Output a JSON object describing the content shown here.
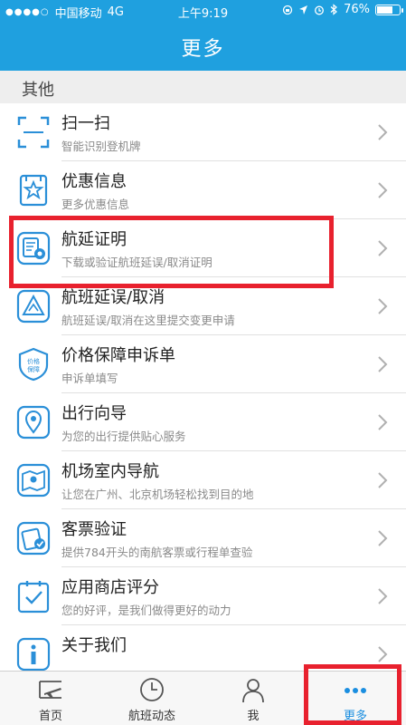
{
  "status_bar": {
    "carrier": "中国移动",
    "network": "4G",
    "time": "上午9:19",
    "battery_text": "76%",
    "battery_level": 0.76
  },
  "header": {
    "title": "更多"
  },
  "section": {
    "label": "其他"
  },
  "items": [
    {
      "title": "扫一扫",
      "subtitle": "智能识别登机牌",
      "icon": "scan-icon"
    },
    {
      "title": "优惠信息",
      "subtitle": "更多优惠信息",
      "icon": "promo-icon"
    },
    {
      "title": "航延证明",
      "subtitle": "下载或验证航班延误/取消证明",
      "icon": "certificate-icon"
    },
    {
      "title": "航班延误/取消",
      "subtitle": "航班延误/取消在这里提交变更申请",
      "icon": "delay-icon"
    },
    {
      "title": "价格保障申诉单",
      "subtitle": "申诉单填写",
      "icon": "price-guarantee-icon",
      "icon_text": "价格保障"
    },
    {
      "title": "出行向导",
      "subtitle": "为您的出行提供贴心服务",
      "icon": "location-pin-icon"
    },
    {
      "title": "机场室内导航",
      "subtitle": "让您在广州、北京机场轻松找到目的地",
      "icon": "map-icon"
    },
    {
      "title": "客票验证",
      "subtitle": "提供784开头的南航客票或行程单查验",
      "icon": "ticket-verify-icon"
    },
    {
      "title": "应用商店评分",
      "subtitle": "您的好评，是我们做得更好的动力",
      "icon": "rating-icon"
    },
    {
      "title": "关于我们",
      "subtitle": "",
      "icon": "info-icon"
    }
  ],
  "tabs": [
    {
      "label": "首页",
      "icon": "home-plane-icon",
      "active": false
    },
    {
      "label": "航班动态",
      "icon": "clock-icon",
      "active": false
    },
    {
      "label": "我",
      "icon": "person-icon",
      "active": false
    },
    {
      "label": "更多",
      "icon": "more-dots-icon",
      "active": true
    }
  ],
  "colors": {
    "accent": "#1fa0df",
    "icon_blue": "#2a8fd8",
    "highlight": "#e8212e",
    "active_tab": "#1a8ee0"
  }
}
